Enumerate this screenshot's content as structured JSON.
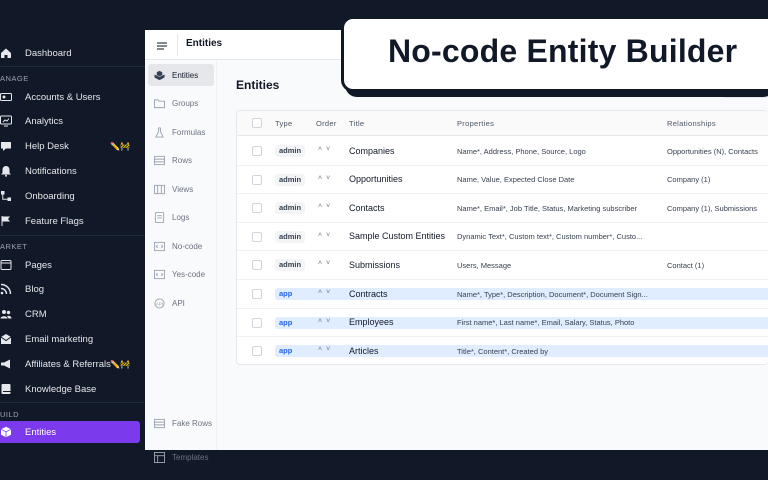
{
  "sidebar": {
    "dashboard": "Dashboard",
    "sections": {
      "manage": "ANAGE",
      "market": "ARKET",
      "build": "UILD"
    },
    "items": [
      {
        "label": "Accounts & Users",
        "icon": "user-card-icon"
      },
      {
        "label": "Analytics",
        "icon": "chart-icon"
      },
      {
        "label": "Help Desk",
        "icon": "help-icon",
        "badge": "✏️🚧"
      },
      {
        "label": "Notifications",
        "icon": "bell-icon"
      },
      {
        "label": "Onboarding",
        "icon": "flow-icon"
      },
      {
        "label": "Feature Flags",
        "icon": "flag-icon"
      },
      {
        "label": "Pages",
        "icon": "pages-icon"
      },
      {
        "label": "Blog",
        "icon": "rss-icon"
      },
      {
        "label": "CRM",
        "icon": "users-icon"
      },
      {
        "label": "Email marketing",
        "icon": "mail-icon"
      },
      {
        "label": "Affiliates & Referrals",
        "icon": "megaphone-icon",
        "badge": "✏️🚧"
      },
      {
        "label": "Knowledge Base",
        "icon": "book-icon"
      },
      {
        "label": "Entities",
        "icon": "cube-icon"
      }
    ]
  },
  "header": {
    "title": "Entities"
  },
  "subnav": {
    "items": [
      "Entities",
      "Groups",
      "Formulas",
      "Rows",
      "Views",
      "Logs",
      "No-code",
      "Yes-code",
      "API"
    ],
    "bottom": [
      "Fake Rows",
      "Templates"
    ]
  },
  "content": {
    "title": "Entities",
    "columns": [
      "Type",
      "Order",
      "Title",
      "Properties",
      "Relationships"
    ],
    "order_arrows": "˄˅",
    "rows": [
      {
        "type": "admin",
        "title": "Companies",
        "properties": "Name*, Address, Phone, Source, Logo",
        "relationships": "Opportunities (N), Contacts"
      },
      {
        "type": "admin",
        "title": "Opportunities",
        "properties": "Name, Value, Expected Close Date",
        "relationships": "Company (1)"
      },
      {
        "type": "admin",
        "title": "Contacts",
        "properties": "Name*, Email*, Job Title, Status, Marketing subscriber",
        "relationships": "Company (1), Submissions"
      },
      {
        "type": "admin",
        "title": "Sample Custom Entities",
        "properties": "Dynamic Text*, Custom text*, Custom number*, Custo...",
        "relationships": ""
      },
      {
        "type": "admin",
        "title": "Submissions",
        "properties": "Users, Message",
        "relationships": "Contact (1)"
      },
      {
        "type": "app",
        "title": "Contracts",
        "properties": "Name*, Type*, Description, Document*, Document Sign...",
        "relationships": ""
      },
      {
        "type": "app",
        "title": "Employees",
        "properties": "First name*, Last name*, Email, Salary, Status, Photo",
        "relationships": ""
      },
      {
        "type": "app",
        "title": "Articles",
        "properties": "Title*, Content*, Created by",
        "relationships": ""
      }
    ]
  },
  "callout": {
    "text": "No-code Entity Builder"
  },
  "colors": {
    "sidebar_bg": "#111827",
    "accent": "#7c3aed",
    "app_badge": "#2563eb"
  }
}
